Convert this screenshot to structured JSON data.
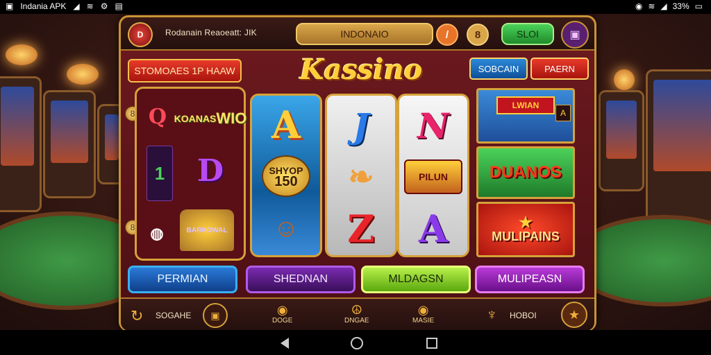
{
  "status_bar": {
    "app_name": "Indania APK",
    "time_right": "33%"
  },
  "app": {
    "title": "Rodanain Reaoeatt: JIK",
    "logo_text": "D",
    "search_label": "INDONAIO",
    "round_btn_1": "/",
    "round_btn_2": "8",
    "slot_label": "SLOI",
    "promo_label": "STOMOAES 1P HAAW",
    "brand": "Kassino",
    "tag_1": "SOBCAIN",
    "tag_2": "PAERN"
  },
  "left_panel": {
    "sym_q": "Q",
    "wild_line1": "KOANAS",
    "wild_line2": "WIO",
    "sym_one": "1",
    "sym_d": "D",
    "bonus": "BARKOWAL",
    "coin": "8"
  },
  "reels": {
    "r1_top": "A",
    "r1_mid_line1": "SHYOP",
    "r1_mid_line2": "150",
    "r2_top": "J",
    "r2_bot": "Z",
    "r3_top": "N",
    "r3_mid": "PILUN",
    "r3_bot": "A"
  },
  "tiles": {
    "tile_1_banner": "LWIAN",
    "tile_1_badge": "A",
    "tile_2": "DUANOS",
    "tile_3": "MULIPAINS"
  },
  "categories": [
    {
      "label": "PERMIAN"
    },
    {
      "label": "SHEDNAN"
    },
    {
      "label": "MLDAGSN"
    },
    {
      "label": "MULIPEASN"
    }
  ],
  "bottom_bar": {
    "left_label": "SOGAHE",
    "item_1": "DOGE",
    "item_2": "DNGAE",
    "item_3": "MASIE",
    "right_label": "HOBOI"
  }
}
